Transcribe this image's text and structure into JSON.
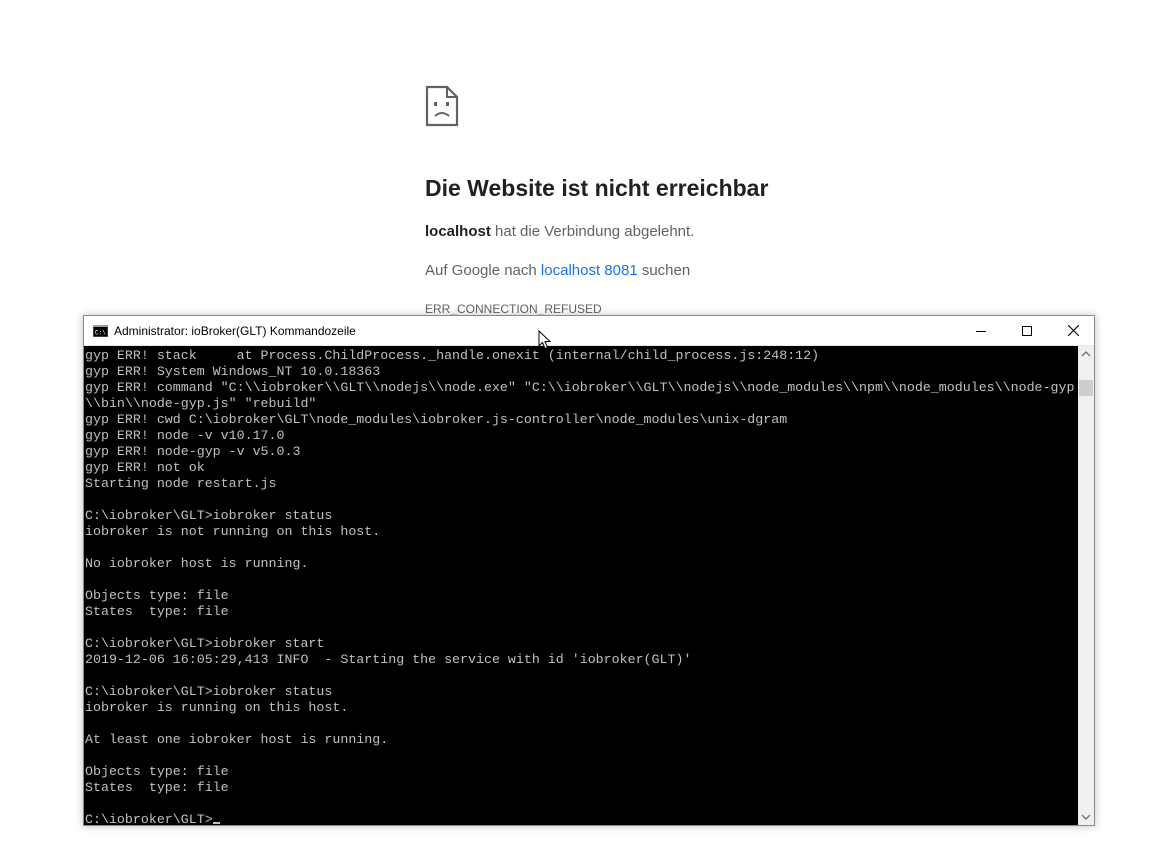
{
  "browser_error": {
    "title": "Die Website ist nicht erreichbar",
    "host_bold": "localhost",
    "refused_text": " hat die Verbindung abgelehnt.",
    "search_prefix": "Auf Google nach ",
    "search_link": "localhost 8081",
    "search_suffix": " suchen",
    "error_code": "ERR_CONNECTION_REFUSED"
  },
  "console": {
    "title": "Administrator: ioBroker(GLT) Kommandozeile",
    "output": "gyp ERR! stack     at Process.ChildProcess._handle.onexit (internal/child_process.js:248:12)\ngyp ERR! System Windows_NT 10.0.18363\ngyp ERR! command \"C:\\\\iobroker\\\\GLT\\\\nodejs\\\\node.exe\" \"C:\\\\iobroker\\\\GLT\\\\nodejs\\\\node_modules\\\\npm\\\\node_modules\\\\node-gyp\n\\\\bin\\\\node-gyp.js\" \"rebuild\"\ngyp ERR! cwd C:\\iobroker\\GLT\\node_modules\\iobroker.js-controller\\node_modules\\unix-dgram\ngyp ERR! node -v v10.17.0\ngyp ERR! node-gyp -v v5.0.3\ngyp ERR! not ok\nStarting node restart.js\n\nC:\\iobroker\\GLT>iobroker status\niobroker is not running on this host.\n\nNo iobroker host is running.\n\nObjects type: file\nStates  type: file\n\nC:\\iobroker\\GLT>iobroker start\n2019-12-06 16:05:29,413 INFO  - Starting the service with id 'iobroker(GLT)'\n\nC:\\iobroker\\GLT>iobroker status\niobroker is running on this host.\n\nAt least one iobroker host is running.\n\nObjects type: file\nStates  type: file\n\n",
    "prompt": "C:\\iobroker\\GLT>"
  },
  "icons": {
    "page": "sad-document-icon",
    "window": "cmd-icon",
    "minimize": "minimize-icon",
    "maximize": "maximize-icon",
    "close": "close-icon"
  },
  "colors": {
    "link": "#1a73e8",
    "console_bg": "#000000",
    "console_text": "#c0c0c0",
    "title_text": "#202124",
    "body_text": "#5f6368"
  }
}
